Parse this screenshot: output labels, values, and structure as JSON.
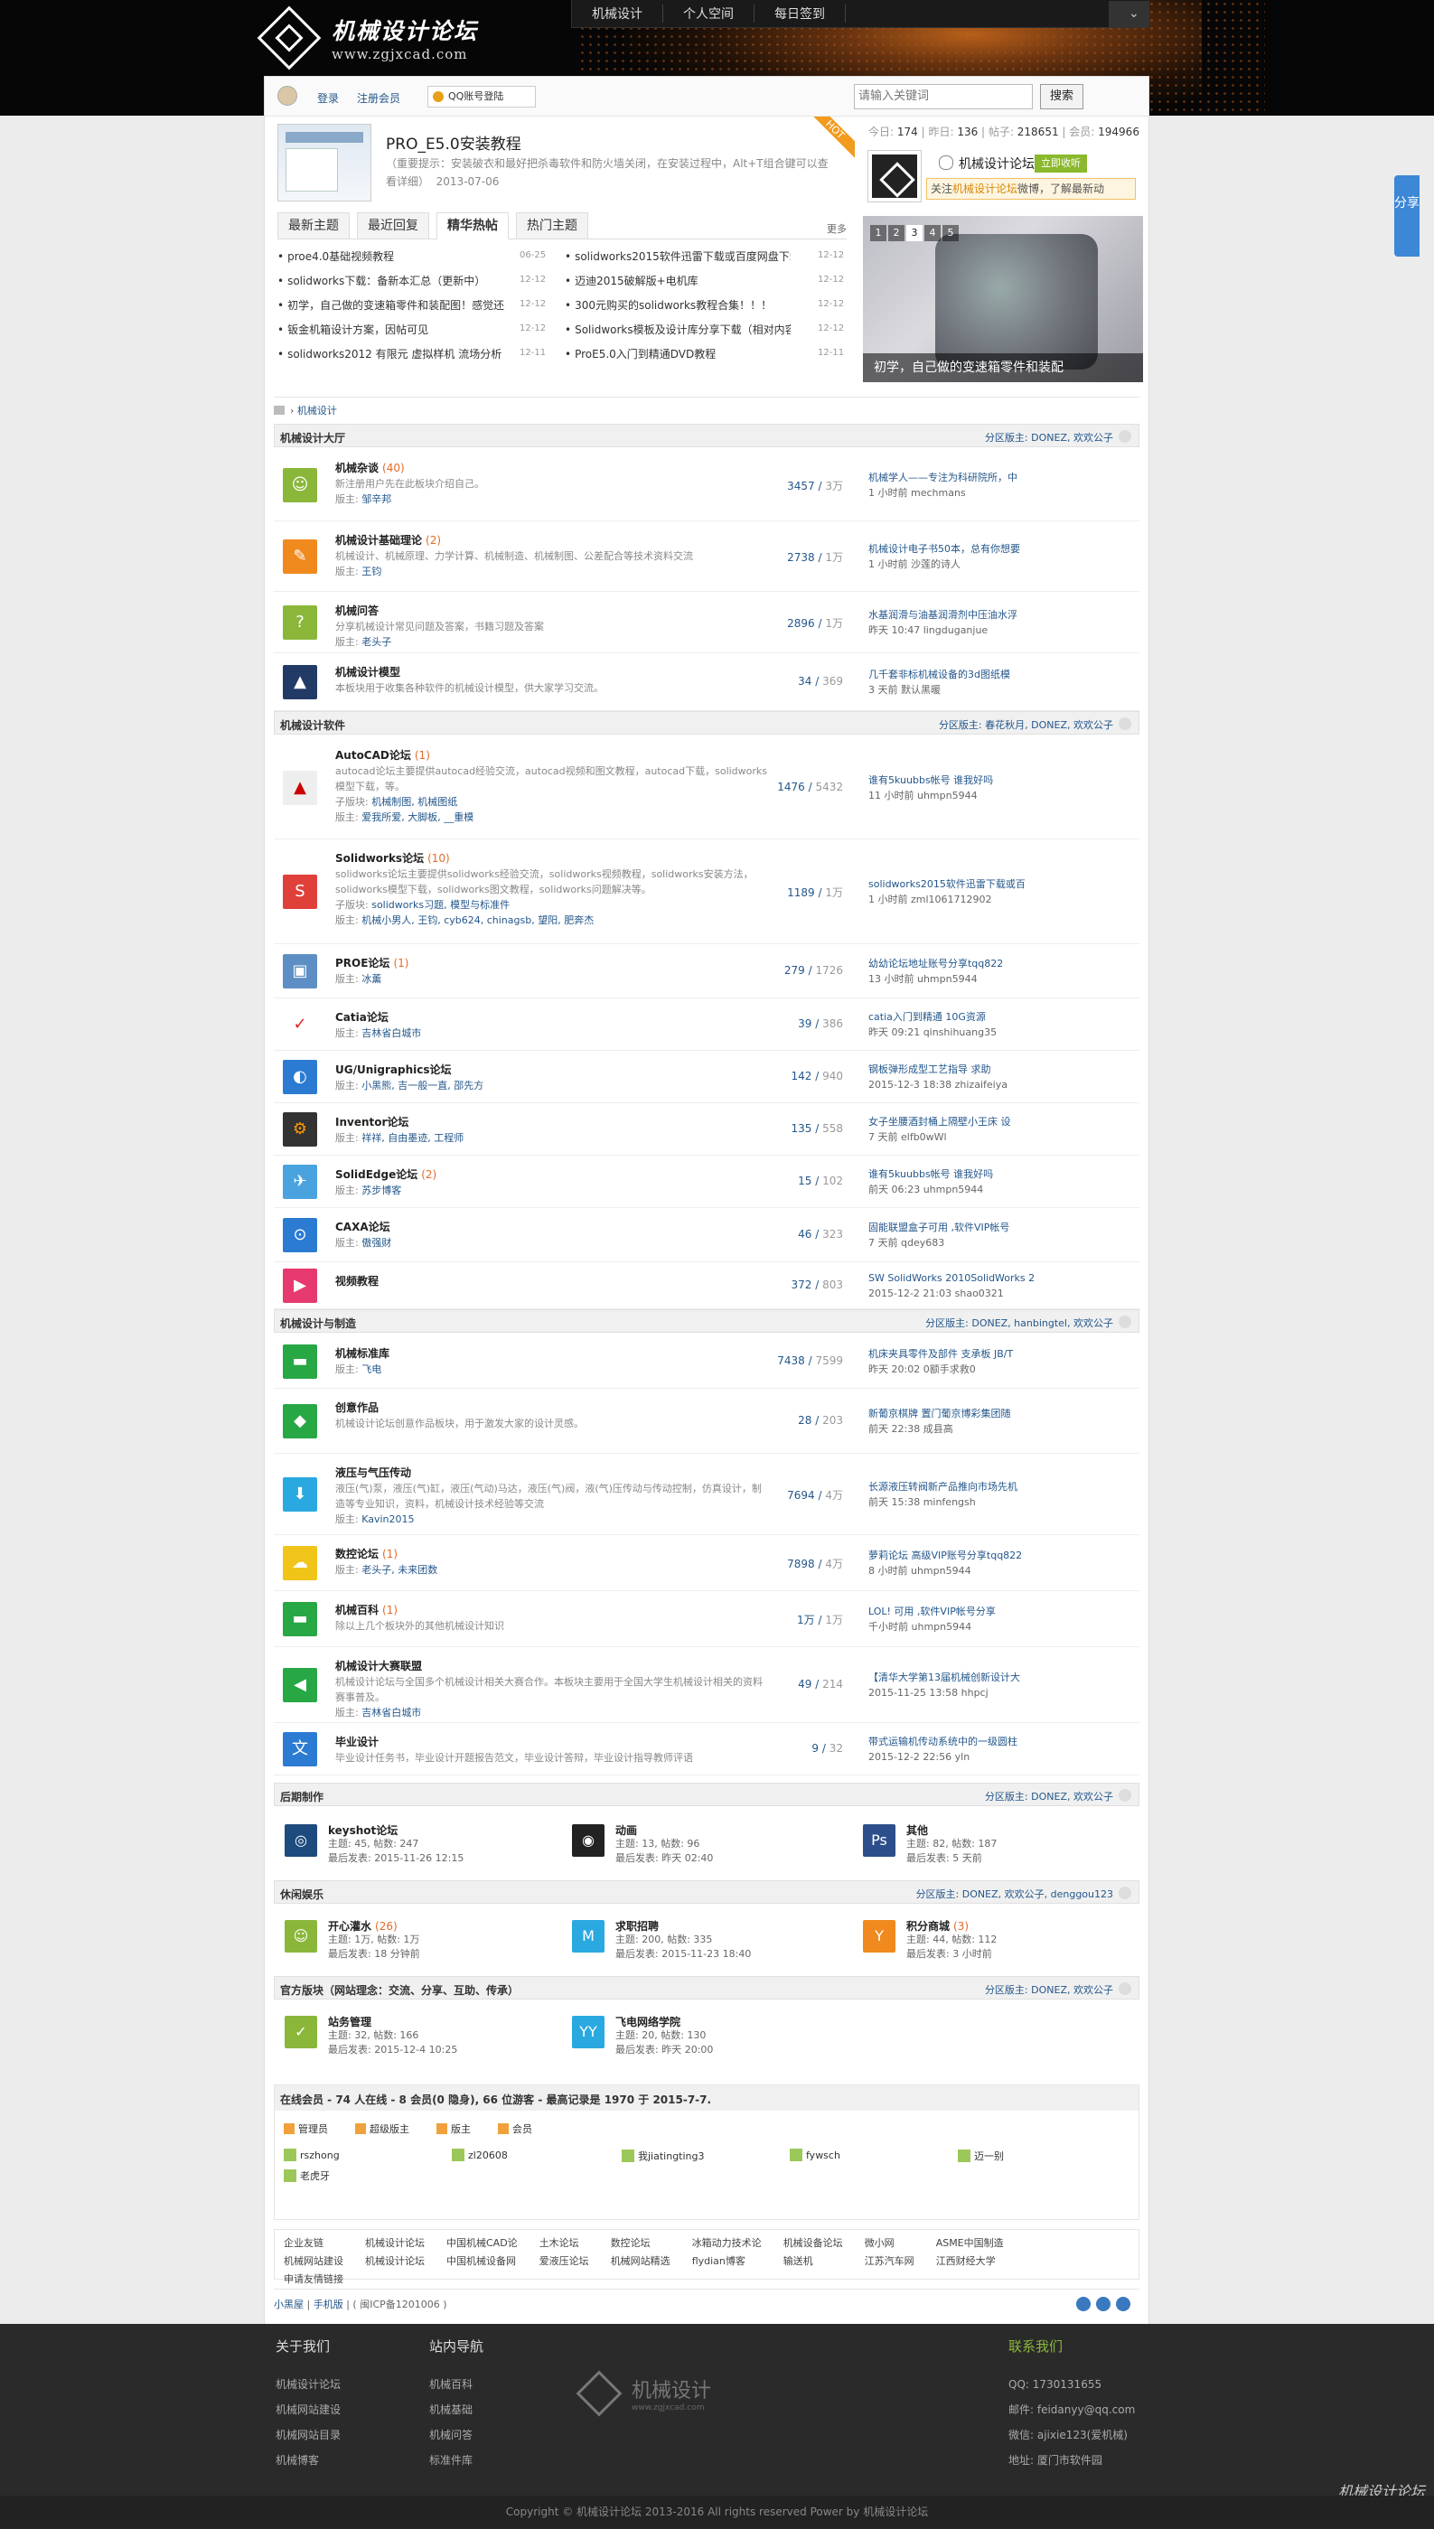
{
  "site": {
    "name": "机械设计论坛",
    "url": "www.zgjxcad.com",
    "nav": [
      "机械设计",
      "个人空间",
      "每日签到"
    ]
  },
  "userbar": {
    "login": "登录",
    "register": "注册会员",
    "qq": "QQ账号登陆",
    "search_placeholder": "请输入关键词",
    "search_btn": "搜索"
  },
  "featured": {
    "title": "PRO_E5.0安装教程",
    "desc": "（重要提示：安装破衣和最好把杀毒软件和防火墙关闭，在安装过程中，Alt+T组合键可以查看详细）",
    "date": "2013-07-06",
    "badge": "HOT"
  },
  "stats": {
    "today_l": "今日:",
    "today": "174",
    "yest_l": "昨日:",
    "yest": "136",
    "posts_l": "帖子:",
    "posts": "218651",
    "members_l": "会员:",
    "members": "194966"
  },
  "weibo": {
    "name": "机械设计论坛",
    "follow": "立即收听",
    "note_a": "关注",
    "note_b": "机械设计论坛",
    "note_c": "微博，了解最新动"
  },
  "tabs": [
    "最新主题",
    "最近回复",
    "精华热帖",
    "热门主题"
  ],
  "tabs_more": "更多",
  "hot": [
    {
      "t": "proe4.0基础视频教程",
      "d": "06-25"
    },
    {
      "t": "solidworks2015软件迅雷下载或百度网盘下载",
      "d": "12-12"
    },
    {
      "t": "solidworks下载：备新本汇总（更新中）",
      "d": "12-12"
    },
    {
      "t": "迈迪2015破解版+电机库",
      "d": "12-12"
    },
    {
      "t": "初学，自己做的变速箱零件和装配图！感觉还",
      "d": "12-12"
    },
    {
      "t": "300元购买的solidworks教程合集！！！",
      "d": "12-12"
    },
    {
      "t": "钣金机箱设计方案，因帖可见",
      "d": "12-12"
    },
    {
      "t": "Solidworks模板及设计库分享下载（相对内容",
      "d": "12-12"
    },
    {
      "t": "solidworks2012 有限元 虚拟样机 流场分析",
      "d": "12-11"
    },
    {
      "t": "ProE5.0入门到精通DVD教程",
      "d": "12-11"
    }
  ],
  "slider": {
    "nums": [
      "1",
      "2",
      "3",
      "4",
      "5"
    ],
    "caption": "初学，自己做的变速箱零件和装配"
  },
  "crumb": "机械设计",
  "sections": [
    {
      "title": "机械设计大厅",
      "mods_l": "分区版主:",
      "mods": "DONEZ, 欢欢公子"
    },
    {
      "title": "机械设计软件",
      "mods_l": "分区版主:",
      "mods": "春花秋月, DONEZ, 欢欢公子"
    },
    {
      "title": "机械设计与制造",
      "mods_l": "分区版主:",
      "mods": "DONEZ, hanbingtel, 欢欢公子"
    },
    {
      "title": "后期制作",
      "mods_l": "分区版主:",
      "mods": "DONEZ, 欢欢公子"
    },
    {
      "title": "休闲娱乐",
      "mods_l": "分区版主:",
      "mods": "DONEZ, 欢欢公子, denggou123"
    },
    {
      "title": "官方版块（网站理念：交流、分享、互助、传承）",
      "mods_l": "分区版主:",
      "mods": "DONEZ, 欢欢公子"
    }
  ],
  "forums": [
    {
      "name": "机械杂谈",
      "new": "(40)",
      "desc": "新注册用户先在此板块介绍自己。",
      "mod_l": "版主:",
      "mod": "邹辛邦",
      "cnt": "3457",
      "tot": "3万",
      "lp": "机械学人——专注为科研院所，中",
      "lt": "1 小时前  mechmans"
    },
    {
      "name": "机械设计基础理论",
      "new": "(2)",
      "desc": "机械设计、机械原理、力学计算、机械制造、机械制图、公差配合等技术资料交流",
      "mod_l": "版主:",
      "mod": "王钧",
      "cnt": "2738",
      "tot": "1万",
      "lp": "机械设计电子书50本，总有你想要",
      "lt": "1 小时前  沙莲的诗人"
    },
    {
      "name": "机械问答",
      "new": "",
      "desc": "分享机械设计常见问题及答案，书籍习题及答案",
      "mod_l": "版主:",
      "mod": "老头子",
      "cnt": "2896",
      "tot": "1万",
      "lp": "水基润滑与油基润滑剂中压油水浮",
      "lt": "昨天 10:47  lingduganjue"
    },
    {
      "name": "机械设计模型",
      "new": "",
      "desc": "本板块用于收集各种软件的机械设计模型，供大家学习交流。",
      "mod_l": "",
      "mod": "",
      "cnt": "34",
      "tot": "369",
      "lp": "几千套非标机械设备的3d图纸模",
      "lt": "3 天前  默认黑暖"
    },
    {
      "name": "AutoCAD论坛",
      "new": "(1)",
      "desc": "autocad论坛主要提供autocad经验交流，autocad视频和图文教程，autocad下载，solidworks模型下载，等。",
      "sub_l": "子版块:",
      "sub": "机械制图, 机械图纸",
      "mod_l": "版主:",
      "mod": "爱我所爱, 大脚板, __重模",
      "cnt": "1476",
      "tot": "5432",
      "lp": "谁有5kuubbs帐号 谁我好吗",
      "lt": "11 小时前  uhmpn5944"
    },
    {
      "name": "Solidworks论坛",
      "new": "(10)",
      "desc": "solidworks论坛主要提供solidworks经验交流，solidworks视频教程，solidworks安装方法，solidworks模型下载，solidworks图文教程，solidworks问题解决等。",
      "sub_l": "子版块:",
      "sub": "solidworks习题, 模型与标准件",
      "mod_l": "版主:",
      "mod": "机械小男人, 王钧, cyb624, chinagsb, 望阳, 肥奔杰",
      "cnt": "1189",
      "tot": "1万",
      "lp": "solidworks2015软件迅雷下载或百",
      "lt": "1 小时前  zml1061712902"
    },
    {
      "name": "PROE论坛",
      "new": "(1)",
      "desc": "",
      "mod_l": "版主:",
      "mod": "冰薰",
      "cnt": "279",
      "tot": "1726",
      "lp": "幼幼论坛地址账号分享tqq822",
      "lt": "13 小时前  uhmpn5944"
    },
    {
      "name": "Catia论坛",
      "new": "",
      "desc": "",
      "mod_l": "版主:",
      "mod": "吉林省白城市",
      "cnt": "39",
      "tot": "386",
      "lp": "catia入门到精通 10G资源",
      "lt": "昨天 09:21  qinshihuang35"
    },
    {
      "name": "UG/Unigraphics论坛",
      "new": "",
      "desc": "",
      "mod_l": "版主:",
      "mod": "小黑熊, 吉一般一直, 邵先方",
      "cnt": "142",
      "tot": "940",
      "lp": "钢板弹形成型工艺指导 求助",
      "lt": "2015-12-3 18:38  zhizaifeiya"
    },
    {
      "name": "Inventor论坛",
      "new": "",
      "desc": "",
      "mod_l": "版主:",
      "mod": "祥祥, 自由墨迹, 工程师",
      "cnt": "135",
      "tot": "558",
      "lp": "女子坐腰酒封桶上隔壁小王床 设",
      "lt": "7 天前  elfb0wWl"
    },
    {
      "name": "SolidEdge论坛",
      "new": "(2)",
      "desc": "",
      "mod_l": "版主:",
      "mod": "苏步博客",
      "cnt": "15",
      "tot": "102",
      "lp": "谁有5kuubbs帐号 谁我好吗",
      "lt": "前天 06:23  uhmpn5944"
    },
    {
      "name": "CAXA论坛",
      "new": "",
      "desc": "",
      "mod_l": "版主:",
      "mod": "傲强财",
      "cnt": "46",
      "tot": "323",
      "lp": "固能联盟盒子可用 ,软件VIP帐号",
      "lt": "7 天前  qdey683"
    },
    {
      "name": "视频教程",
      "new": "",
      "desc": "",
      "mod_l": "",
      "mod": "",
      "cnt": "372",
      "tot": "803",
      "lp": "SW SolidWorks 2010SolidWorks 2",
      "lt": "2015-12-2 21:03  shao0321"
    },
    {
      "name": "机械标准库",
      "new": "",
      "desc": "",
      "mod_l": "版主:",
      "mod": "飞电",
      "cnt": "7438",
      "tot": "7599",
      "lp": "机床夹具零件及部件 支承板 JB/T",
      "lt": "昨天 20:02  0额手求救0"
    },
    {
      "name": "创意作品",
      "new": "",
      "desc": "机械设计论坛创意作品板块，用于激发大家的设计灵感。",
      "mod_l": "",
      "mod": "",
      "cnt": "28",
      "tot": "203",
      "lp": "新葡京棋牌 置门葡京博彩集团随",
      "lt": "前天 22:38  成县高"
    },
    {
      "name": "液压与气压传动",
      "new": "",
      "desc": "液压(气)泵，液压(气)缸，液压(气动)马达，液压(气)阀，液(气)压传动与传动控制，仿真设计，制造等专业知识，资料，机械设计技术经验等交流",
      "mod_l": "版主:",
      "mod": "Kavin2015",
      "cnt": "7694",
      "tot": "4万",
      "lp": "长源液压转阀新产品推向市场先机",
      "lt": "前天 15:38  minfengsh"
    },
    {
      "name": "数控论坛",
      "new": "(1)",
      "desc": "",
      "mod_l": "版主:",
      "mod": "老头子, 未来团数",
      "cnt": "7898",
      "tot": "4万",
      "lp": "萝莉论坛 高级VIP账号分享tqq822",
      "lt": "8 小时前  uhmpn5944"
    },
    {
      "name": "机械百科",
      "new": "(1)",
      "desc": "除以上几个板块外的其他机械设计知识",
      "mod_l": "",
      "mod": "",
      "cnt": "1万",
      "tot": "1万",
      "lp": "LOL! 可用 ,软件VIP帐号分享",
      "lt": "千小时前  uhmpn5944"
    },
    {
      "name": "机械设计大赛联盟",
      "new": "",
      "desc": "机械设计论坛与全国多个机械设计相关大赛合作。本板块主要用于全国大学生机械设计相关的资料赛事普及。",
      "mod_l": "版主:",
      "mod": "吉林省白城市",
      "cnt": "49",
      "tot": "214",
      "lp": "【清华大学第13届机械创新设计大",
      "lt": "2015-11-25 13:58  hhpcj"
    },
    {
      "name": "毕业设计",
      "new": "",
      "desc": "毕业设计任务书，毕业设计开题报告范文，毕业设计答辩，毕业设计指导教师评语",
      "mod_l": "",
      "mod": "",
      "cnt": "9",
      "tot": "32",
      "lp": "带式运输机传动系统中的一级圆柱",
      "lt": "2015-12-2 22:56  yln"
    }
  ],
  "cells": [
    {
      "name": "keyshot论坛",
      "new": "",
      "s1": "主题: 45, 帖数: 247",
      "s2": "最后发表: 2015-11-26 12:15"
    },
    {
      "name": "动画",
      "new": "",
      "s1": "主题: 13, 帖数: 96",
      "s2": "最后发表: 昨天 02:40"
    },
    {
      "name": "其他",
      "new": "",
      "s1": "主题: 82, 帖数: 187",
      "s2": "最后发表: 5 天前"
    },
    {
      "name": "开心灌水",
      "new": "(26)",
      "s1": "主题: 1万, 帖数: 1万",
      "s2": "最后发表: 18 分钟前"
    },
    {
      "name": "求职招聘",
      "new": "",
      "s1": "主题: 200, 帖数: 335",
      "s2": "最后发表: 2015-11-23 18:40"
    },
    {
      "name": "积分商城",
      "new": "(3)",
      "s1": "主题: 44, 帖数: 112",
      "s2": "最后发表: 3 小时前"
    },
    {
      "name": "站务管理",
      "new": "",
      "s1": "主题: 32, 帖数: 166",
      "s2": "最后发表: 2015-12-4 10:25"
    },
    {
      "name": "飞电网络学院",
      "new": "",
      "s1": "主题: 20, 帖数: 130",
      "s2": "最后发表: 昨天 20:00"
    }
  ],
  "online": {
    "title": "在线会员 - 74 人在线 - 8 会员(0 隐身), 66 位游客 - 最高记录是 1970 于 2015-7-7.",
    "legend": [
      "管理员",
      "超级版主",
      "版主",
      "会员"
    ],
    "users": [
      "rszhong",
      "zl20608",
      "我jiatingting3",
      "fywsch",
      "迈一别",
      "老虎牙"
    ]
  },
  "links": [
    "企业友链",
    "机械设计论坛",
    "中国机械CAD论",
    "土木论坛",
    "数控论坛",
    "冰箱动力技术论",
    "机械设备论坛",
    "微小网",
    "ASME中国制造",
    "机械网站建设",
    "机械设计论坛",
    "中国机械设备网",
    "爱液压论坛",
    "机械网站精选",
    "flydian博客",
    "输送机",
    "江苏汽车网",
    "江西财经大学",
    "申请友情链接"
  ],
  "foot1": {
    "a": "小黑屋",
    "b": "手机版",
    "c": "( 闽ICP备1201006 )"
  },
  "footer": {
    "about": "关于我们",
    "about_items": [
      "机械设计论坛",
      "机械网站建设",
      "机械网站目录",
      "机械博客"
    ],
    "nav": "站内导航",
    "nav_items": [
      "机械百科",
      "机械基础",
      "机械问答",
      "标准件库"
    ],
    "logo": "机械设计",
    "logo_url": "www.zgjxcad.com",
    "contact": "联系我们",
    "contact_items": [
      "QQ: 1730131655",
      "邮件: feidanyy@qq.com",
      "微信: ajixie123(爱机械)",
      "地址: 厦门市软件园"
    ],
    "copy": "Copyright © 机械设计论坛 2013-2016 All rights reserved Power by 机械设计论坛",
    "wm": "机械设计论坛"
  },
  "share": "分享",
  "colors": {
    "green": "#8ab73a",
    "orange": "#f08a1e",
    "blue": "#2b7bd3",
    "navy": "#223a66",
    "red": "#e0403a"
  }
}
